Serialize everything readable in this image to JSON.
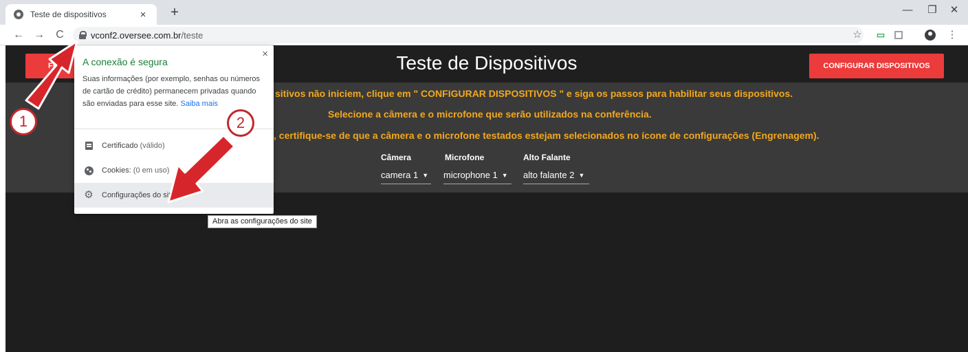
{
  "browser": {
    "tab": {
      "title": "Teste de dispositivos",
      "close": "×",
      "favicon": "globe-icon"
    },
    "new_tab": "+",
    "window_controls": {
      "minimize": "—",
      "maximize": "❐",
      "close": "✕"
    },
    "nav": {
      "back": "←",
      "forward": "→",
      "reload": "C"
    },
    "url": {
      "host": "vconf2.oversee.com.br",
      "path": "/teste"
    },
    "toolbar_icons": {
      "star": "☆",
      "extension_tv": "📺",
      "menu": "⋮"
    }
  },
  "page": {
    "title": "Teste de Dispositivos",
    "left_button": "FE",
    "configure_button": "CONFIGURAR DISPOSITIVOS",
    "instructions": [
      "sitivos não iniciem, clique em \" CONFIGURAR DISPOSITIVOS \" e siga os passos para habilitar seus dispositivos.",
      "Selecione a câmera e o microfone que serão utilizados na conferência.",
      ", certifique-se de que a câmera e o microfone testados estejam selecionados no ícone de configurações (Engrenagem)."
    ],
    "devices": {
      "camera": {
        "label": "Câmera",
        "value": "camera 1"
      },
      "microphone": {
        "label": "Microfone",
        "value": "microphone 1"
      },
      "speaker": {
        "label": "Alto Falante",
        "value": "alto falante 2"
      }
    },
    "colors": {
      "accent_red": "#ec3b3b",
      "instruction_orange": "#f3a81d",
      "secure_green": "#188038"
    }
  },
  "popup": {
    "close": "×",
    "heading": "A conexão é segura",
    "description": "Suas informações (por exemplo, senhas ou números de cartão de crédito) permanecem privadas quando são enviadas para esse site.",
    "learn_more": "Saiba mais",
    "items": [
      {
        "label": "Certificado",
        "detail": "(válido)",
        "icon": "certificate-icon"
      },
      {
        "label": "Cookies:",
        "detail": "(0 em uso)",
        "icon": "cookie-icon"
      },
      {
        "label": "Configurações do site",
        "detail": "",
        "icon": "gear-icon"
      }
    ],
    "tooltip": "Abra as configurações do site"
  },
  "annotations": {
    "step1": "1",
    "step2": "2",
    "arrow_color": "#d7262b"
  }
}
